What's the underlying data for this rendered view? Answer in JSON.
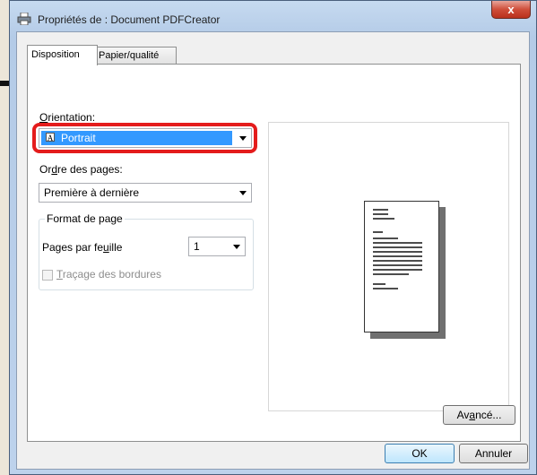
{
  "window": {
    "title": "Propriétés de : Document PDFCreator",
    "close_glyph": "x",
    "printer_icon": "printer-icon"
  },
  "tabs": [
    {
      "label": "Disposition",
      "active": true
    },
    {
      "label": "Papier/qualité",
      "active": false
    }
  ],
  "orientation": {
    "label_u": "O",
    "label_rest": "rientation:",
    "value": "Portrait",
    "icon": "portrait-page-icon",
    "highlight_color": "#e41c1c"
  },
  "page_order": {
    "label_a": "Or",
    "label_u": "d",
    "label_b": "re des pages:",
    "value": "Première à dernière"
  },
  "page_format": {
    "group_title": "Format de page",
    "pages_per_sheet_label_a": "Pages par fe",
    "pages_per_sheet_label_u": "u",
    "pages_per_sheet_label_b": "ille",
    "pages_per_sheet_value": "1",
    "borders_u": "T",
    "borders_rest": "raçage des bordures",
    "borders_checked": false,
    "borders_enabled": false
  },
  "buttons": {
    "advanced_a": "Av",
    "advanced_u": "a",
    "advanced_b": "ncé...",
    "ok": "OK",
    "cancel": "Annuler"
  }
}
